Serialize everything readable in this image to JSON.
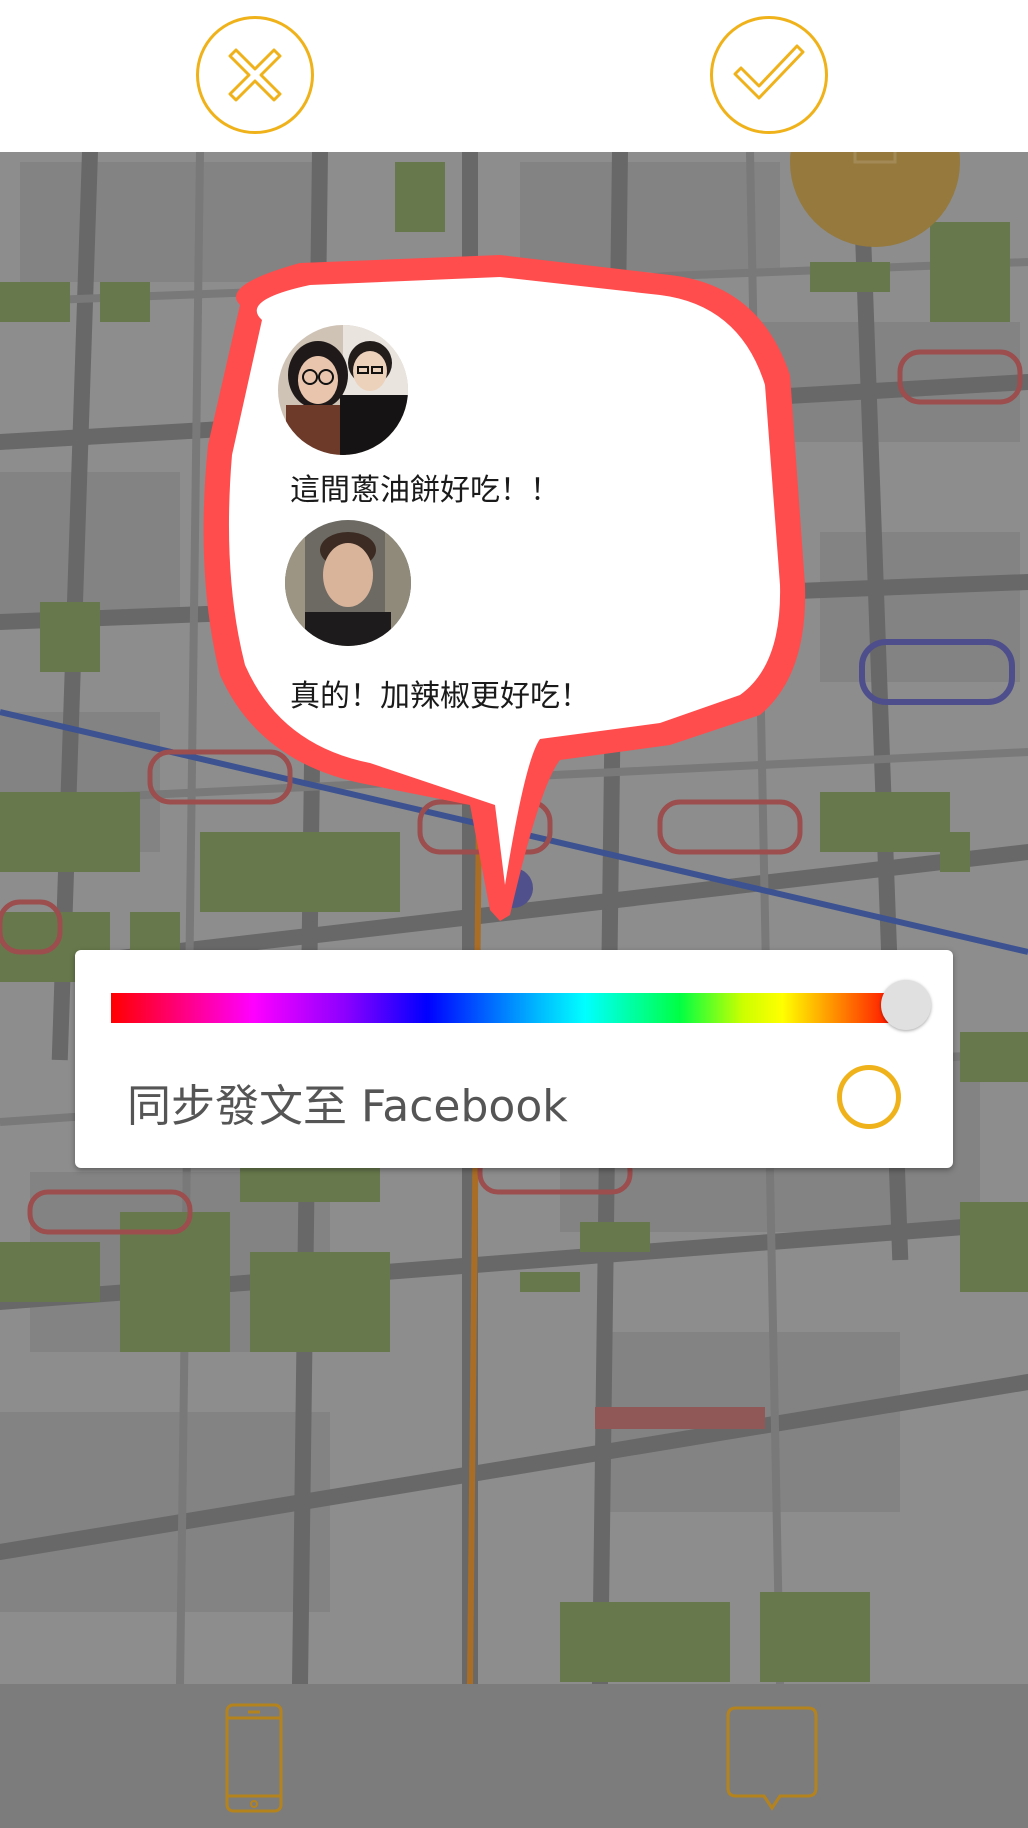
{
  "toolbar": {
    "cancel_icon": "close-icon",
    "confirm_icon": "check-icon",
    "accent_color": "#f0b21a"
  },
  "bubble": {
    "border_color": "#ff4d4d",
    "messages": [
      {
        "avatar": "avatar-couple",
        "text": "這間蔥油餅好吃！！"
      },
      {
        "avatar": "avatar-man",
        "text": "真的！加辣椒更好吃！"
      }
    ]
  },
  "panel": {
    "color_slider_position": 1.0,
    "sync_label": "同步發文至 Facebook",
    "sync_checked": false
  },
  "bottom_nav": {
    "left_icon": "phone-icon",
    "right_icon": "chat-bubble-icon"
  }
}
